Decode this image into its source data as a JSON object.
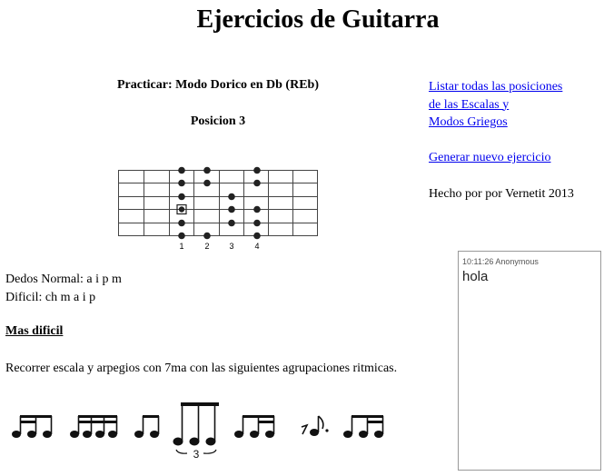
{
  "page": {
    "title": "Ejercicios de Guitarra"
  },
  "exercise": {
    "practice": "Practicar: Modo Dorico en Db (REb)",
    "position": "Posicion 3",
    "finger_labels": [
      "1",
      "2",
      "3",
      "4"
    ],
    "fingers_normal": "Dedos Normal: a i p m",
    "fingers_hard": "Dificil: ch m a i p",
    "hard_heading": "Mas dificil",
    "description": "Recorrer escala y arpegios con 7ma con las siguientes agrupaciones ritmicas.",
    "triplet_label": "3"
  },
  "sidebar": {
    "list_link_line1": "Listar todas las posiciones ",
    "list_link_line2": "de las Escalas y",
    "list_link_line3": "Modos Griegos ",
    "new_exercise": "Generar nuevo ejercicio",
    "credit": "Hecho por por Vernetit 2013"
  },
  "chat": {
    "meta": "10:11:26 Anonymous",
    "message": "hola"
  }
}
